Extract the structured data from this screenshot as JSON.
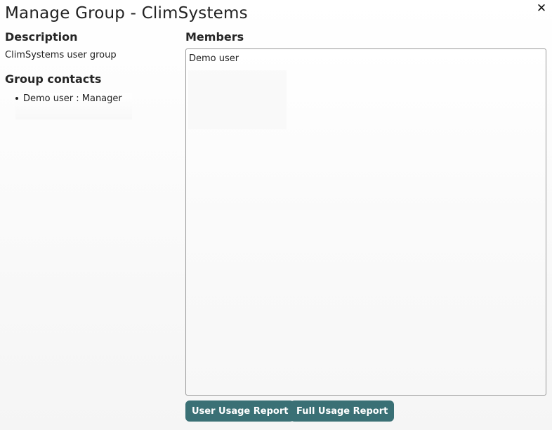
{
  "dialog": {
    "title": "Manage Group - ClimSystems",
    "close_symbol": "✕"
  },
  "description": {
    "heading": "Description",
    "text": "ClimSystems user group"
  },
  "group_contacts": {
    "heading": "Group contacts",
    "items": [
      {
        "label": "Demo user : Manager"
      }
    ]
  },
  "members": {
    "heading": "Members",
    "value": "Demo user"
  },
  "buttons": {
    "user_usage_report": "User Usage Report",
    "full_usage_report": "Full Usage Report"
  },
  "colors": {
    "button_background": "#3a7075",
    "button_text": "#ffffff"
  }
}
